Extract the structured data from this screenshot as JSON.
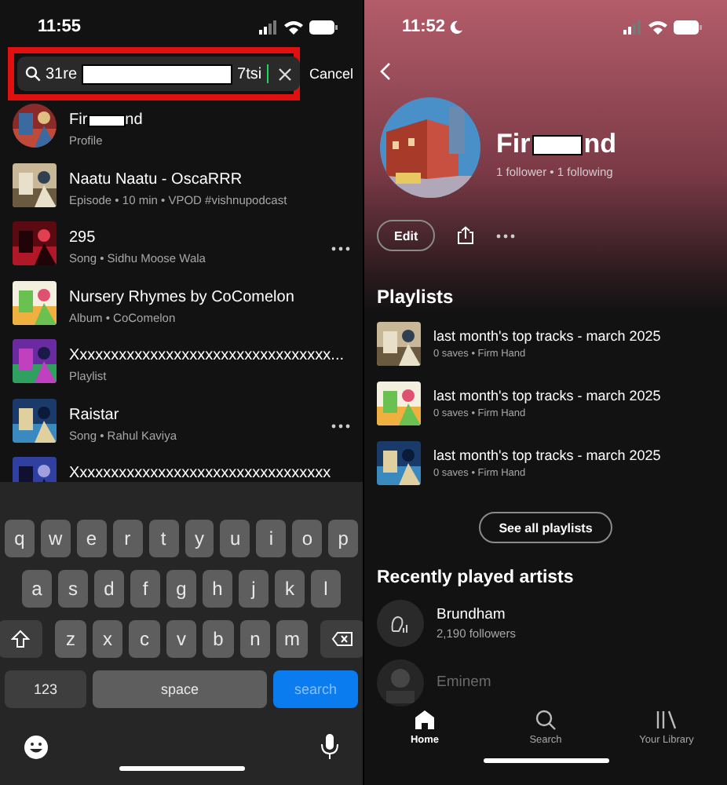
{
  "search_screen": {
    "status_bar": {
      "time": "11:55"
    },
    "search": {
      "value_start": "31re",
      "value_end": "7tsi",
      "cancel": "Cancel"
    },
    "results": [
      {
        "title": "Fir",
        "title_end": "nd",
        "redacted": true,
        "subtitle": "Profile",
        "kind": "profile",
        "more": false
      },
      {
        "title": "Naatu Naatu - OscaRRR",
        "redacted": false,
        "subtitle": "Episode • 10 min • VPOD #vishnupodcast",
        "kind": "item",
        "more": false
      },
      {
        "title": "295",
        "redacted": false,
        "subtitle": "Song • Sidhu Moose Wala",
        "kind": "item",
        "more": true
      },
      {
        "title": "Nursery Rhymes by CoComelon",
        "redacted": false,
        "subtitle": "Album • CoComelon",
        "kind": "item",
        "more": false
      },
      {
        "title": "Xxxxxxxxxxxxxxxxxxxxxxxxxxxxxxxxx...",
        "redacted": false,
        "subtitle": "Playlist",
        "kind": "item",
        "more": false
      },
      {
        "title": "Raistar",
        "redacted": false,
        "subtitle": "Song • Rahul Kaviya",
        "kind": "item",
        "more": true
      },
      {
        "title": "Xxxxxxxxxxxxxxxxxxxxxxxxxxxxxxxxx",
        "redacted": false,
        "kind": "item",
        "more": false
      }
    ],
    "keyboard": {
      "rows": [
        [
          "q",
          "w",
          "e",
          "r",
          "t",
          "y",
          "u",
          "i",
          "o",
          "p"
        ],
        [
          "a",
          "s",
          "d",
          "f",
          "g",
          "h",
          "j",
          "k",
          "l"
        ],
        [
          "z",
          "x",
          "c",
          "v",
          "b",
          "n",
          "m"
        ]
      ],
      "number_key": "123",
      "space_key": "space",
      "action_key": "search"
    }
  },
  "profile_screen": {
    "status_bar": {
      "time": "11:52"
    },
    "name_start": "Fir",
    "name_end": "nd",
    "stats": "1 follower • 1 following",
    "edit": "Edit",
    "playlists": {
      "heading": "Playlists",
      "items": [
        {
          "title": "last month's top tracks - march 2025",
          "subtitle": "0 saves • Firm Hand"
        },
        {
          "title": "last month's top tracks - march 2025",
          "subtitle": "0 saves • Firm Hand"
        },
        {
          "title": "last month's top tracks - march 2025",
          "subtitle": "0 saves • Firm Hand"
        }
      ],
      "button": "See all playlists"
    },
    "artists": {
      "heading": "Recently played artists",
      "items": [
        {
          "name": "Brundham",
          "subtitle": "2,190 followers",
          "kind": "placeholder"
        },
        {
          "name": "Eminem"
        }
      ]
    },
    "nav": [
      {
        "label": "Home",
        "kind": "home",
        "selected": true
      },
      {
        "label": "Search",
        "kind": "search",
        "selected": false
      },
      {
        "label": "Your Library",
        "kind": "library",
        "selected": false
      }
    ]
  }
}
